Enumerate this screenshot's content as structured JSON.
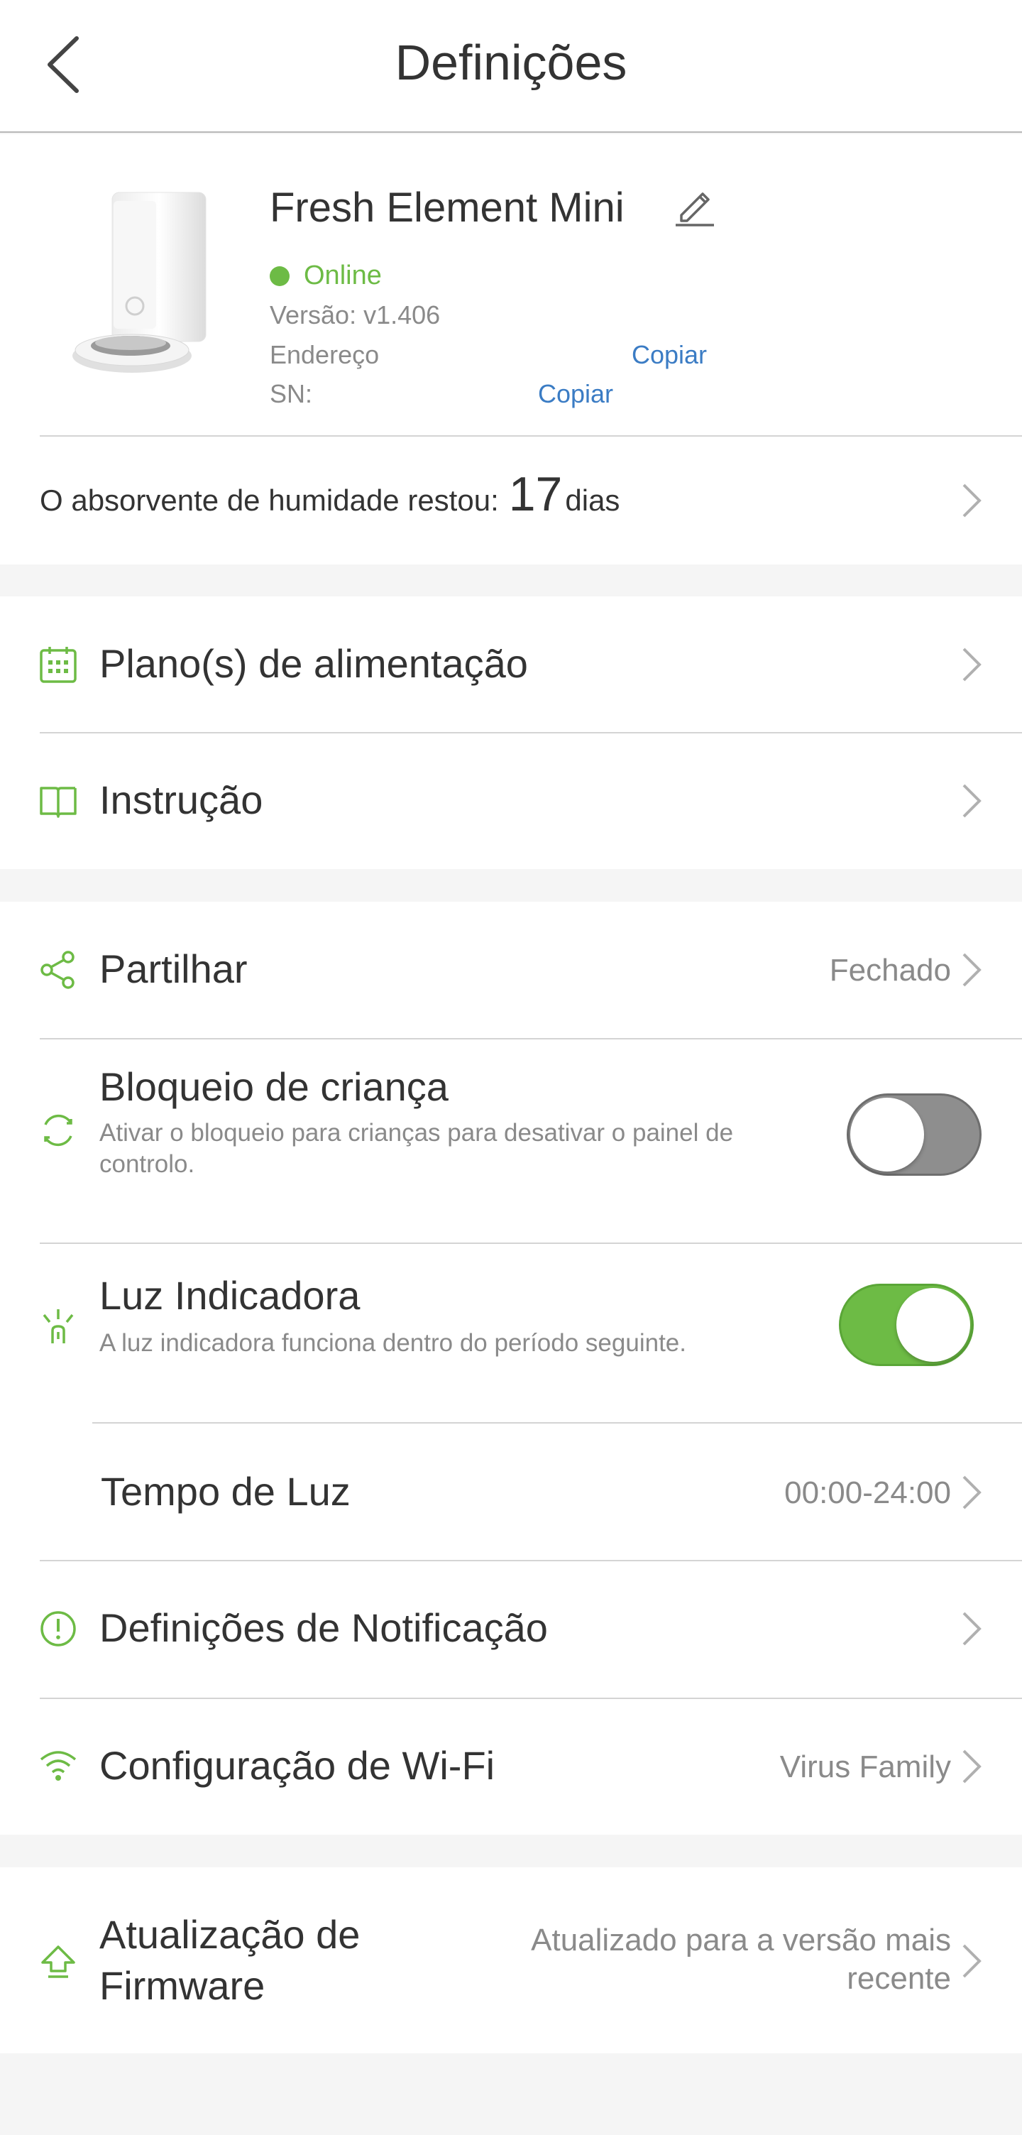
{
  "header": {
    "title": "Definições"
  },
  "device": {
    "name": "Fresh Element Mini",
    "status": "Online",
    "version": "Versão: v1.406",
    "address_label": "Endereço",
    "sn_label": "SN:",
    "copy_label": "Copiar"
  },
  "absorbent": {
    "prefix": "O absorvente de humidade restou:",
    "days": "17",
    "unit": "dias"
  },
  "menu": {
    "feeding_plan": "Plano(s) de alimentação",
    "instruction": "Instrução",
    "share": {
      "label": "Partilhar",
      "value": "Fechado"
    },
    "child_lock": {
      "label": "Bloqueio de criança",
      "sub": "Ativar o bloqueio para crianças para desativar o painel de controlo.",
      "on": false
    },
    "indicator": {
      "label": "Luz Indicadora",
      "sub": "A luz indicadora funciona dentro do período seguinte.",
      "on": true
    },
    "light_time": {
      "label": "Tempo de Luz",
      "value": "00:00-24:00"
    },
    "notification": "Definições de Notificação",
    "wifi": {
      "label": "Configuração de Wi-Fi",
      "value": "Virus Family"
    },
    "firmware": {
      "label_line1": "Atualização de",
      "label_line2": "Firmware",
      "value_line1": "Atualizado para a versão mais",
      "value_line2": "recente"
    }
  },
  "colors": {
    "accent": "#6dbb45",
    "link": "#3b7cc4",
    "toggle_off": "#8e8e8e"
  }
}
